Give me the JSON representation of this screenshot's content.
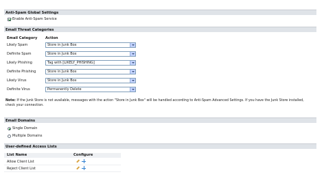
{
  "global": {
    "header": "Anti-Spam Global Settings",
    "enable_label": "Enable Anti-Spam Service",
    "enable_checked": true
  },
  "threats": {
    "header": "Email Threat Categories",
    "col_category": "Email Category",
    "col_action": "Action",
    "rows": [
      {
        "category": "Likely Spam",
        "action": "Store in Junk Box"
      },
      {
        "category": "Definite Spam",
        "action": "Store in Junk Box"
      },
      {
        "category": "Likely Phishing",
        "action": "Tag with [LIKELY_PHISHING]"
      },
      {
        "category": "Definite Phishing",
        "action": "Store in Junk Box"
      },
      {
        "category": "Likely Virus",
        "action": "Store in Junk Box"
      },
      {
        "category": "Definite Virus",
        "action": "Permanently Delete"
      }
    ]
  },
  "note": {
    "label": "Note:",
    "text": "If the Junk Store is not available, messages with the action \"Store in Junk Box\" will be handled according to Anti-Spam Advanced Settings. If you have the Junk Store installed, check your connection."
  },
  "domains": {
    "header": "Email Domains",
    "options": [
      {
        "label": "Single Domain",
        "selected": true
      },
      {
        "label": "Multiple Domains",
        "selected": false
      }
    ]
  },
  "access": {
    "header": "User-defined Access Lists",
    "col_name": "List Name",
    "col_configure": "Configure",
    "rows": [
      {
        "name": "Allow Client List"
      },
      {
        "name": "Reject Client List"
      }
    ]
  },
  "icons": {
    "edit": "pencil-edit-icon",
    "add": "plus-add-icon"
  },
  "colors": {
    "section_header_bg": "#dfe3e8",
    "select_border": "#7f9db9",
    "check_green": "#1b7f2a"
  }
}
